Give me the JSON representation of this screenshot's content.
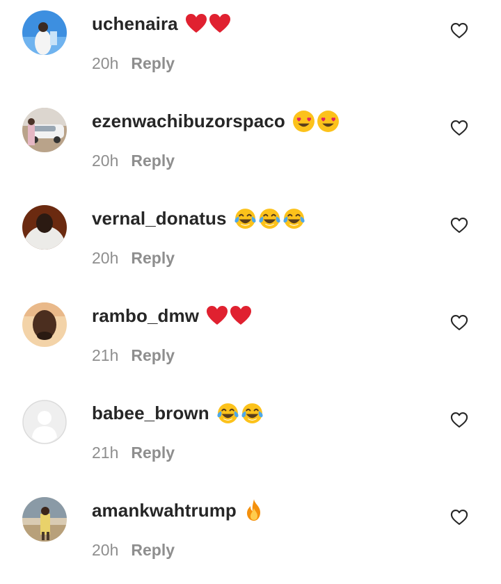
{
  "comments": [
    {
      "username": "uchenaira",
      "time": "20h",
      "reply_label": "Reply",
      "emojis": [
        "red-heart",
        "red-heart"
      ],
      "avatar": "photo-blue-sky"
    },
    {
      "username": "ezenwachibuzorspaco",
      "time": "20h",
      "reply_label": "Reply",
      "emojis": [
        "heart-eyes",
        "heart-eyes"
      ],
      "avatar": "photo-car"
    },
    {
      "username": "vernal_donatus",
      "time": "20h",
      "reply_label": "Reply",
      "emojis": [
        "tears-of-joy",
        "tears-of-joy",
        "tears-of-joy"
      ],
      "avatar": "photo-portrait-dark"
    },
    {
      "username": "rambo_dmw",
      "time": "21h",
      "reply_label": "Reply",
      "emojis": [
        "red-heart",
        "red-heart"
      ],
      "avatar": "photo-portrait-light"
    },
    {
      "username": "babee_brown",
      "time": "21h",
      "reply_label": "Reply",
      "emojis": [
        "tears-of-joy",
        "tears-of-joy"
      ],
      "avatar": "default-avatar"
    },
    {
      "username": "amankwahtrump",
      "time": "20h",
      "reply_label": "Reply",
      "emojis": [
        "fire"
      ],
      "avatar": "photo-street"
    }
  ],
  "colors": {
    "text": "#262626",
    "secondary_text": "#8e8e8e",
    "heart_red": "#e02130",
    "background": "#ffffff"
  },
  "icons": {
    "like": "heart-outline-icon"
  }
}
